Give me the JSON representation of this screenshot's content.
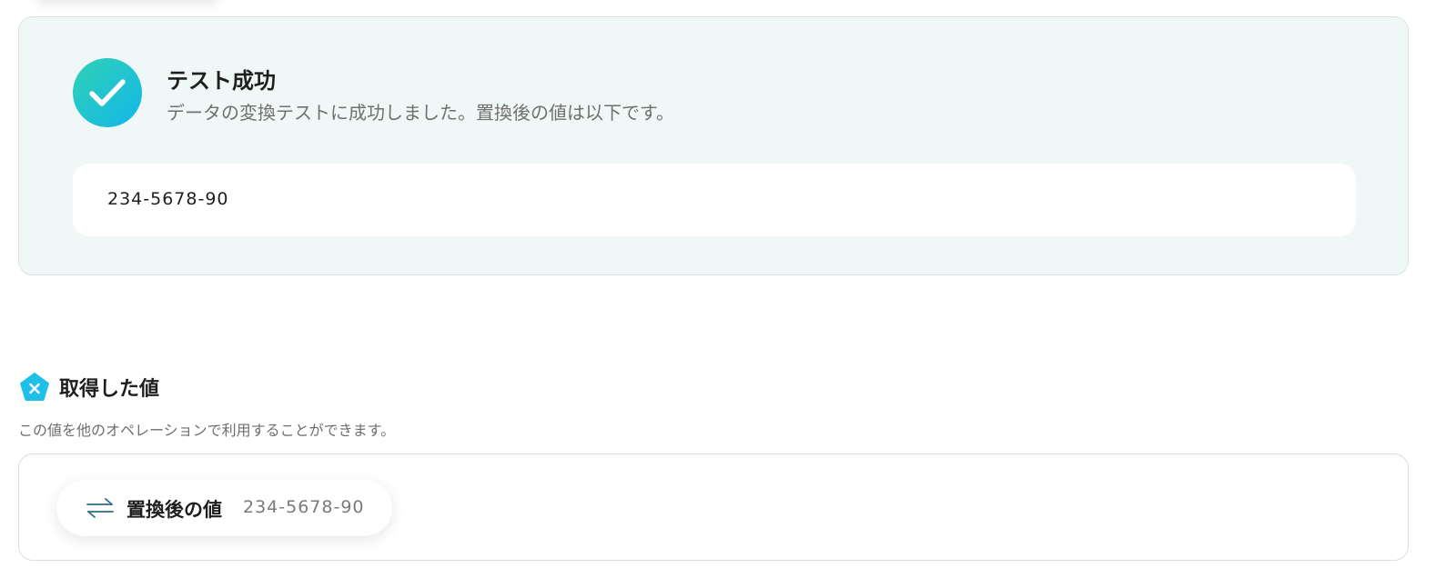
{
  "test_result": {
    "title": "テスト成功",
    "message": "データの変換テストに成功しました。置換後の値は以下です。",
    "value": "234-5678-90",
    "icon": "check-icon"
  },
  "retrieved_values": {
    "title": "取得した値",
    "description": "この値を他のオペレーションで利用することができます。",
    "icon": "variable-x-icon",
    "items": [
      {
        "label": "置換後の値",
        "value": "234-5678-90",
        "icon": "swap-arrows-icon"
      }
    ]
  },
  "colors": {
    "success_bg": "#f0f8f7",
    "accent_gradient_start": "#2fd2b6",
    "accent_gradient_end": "#14b6e8",
    "section_icon": "#1ec0e8"
  }
}
